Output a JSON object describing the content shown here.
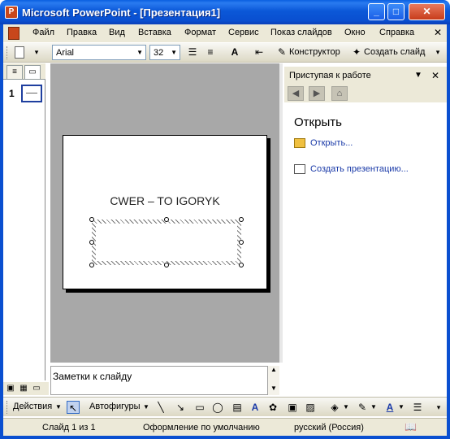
{
  "window": {
    "title": "Microsoft PowerPoint - [Презентация1]",
    "minimize": "_",
    "maximize": "□",
    "close": "✕"
  },
  "menu": {
    "items": [
      "Файл",
      "Правка",
      "Вид",
      "Вставка",
      "Формат",
      "Сервис",
      "Показ слайдов",
      "Окно",
      "Справка"
    ],
    "doc_close": "✕"
  },
  "toolbar": {
    "font": "Arial",
    "font_size": "32",
    "designer_label": "Конструктор",
    "new_slide_label": "Создать слайд"
  },
  "left_panel": {
    "slide_number": "1"
  },
  "slide": {
    "title_text": "CWER – TO IGORYK"
  },
  "notes": {
    "placeholder": "Заметки к слайду"
  },
  "task_pane": {
    "title": "Приступая к работе",
    "section_title": "Открыть",
    "open_link": "Открыть...",
    "create_link": "Создать презентацию..."
  },
  "drawing_toolbar": {
    "actions_label": "Действия",
    "autoshapes_label": "Автофигуры"
  },
  "status": {
    "slide_info": "Слайд 1 из 1",
    "design": "Оформление по умолчанию",
    "language": "русский (Россия)"
  },
  "colors": {
    "titlebar": "#0b58d8",
    "chrome": "#ece9d8",
    "slide_bg_area": "#a8a8a8",
    "link": "#1a3aa8"
  }
}
